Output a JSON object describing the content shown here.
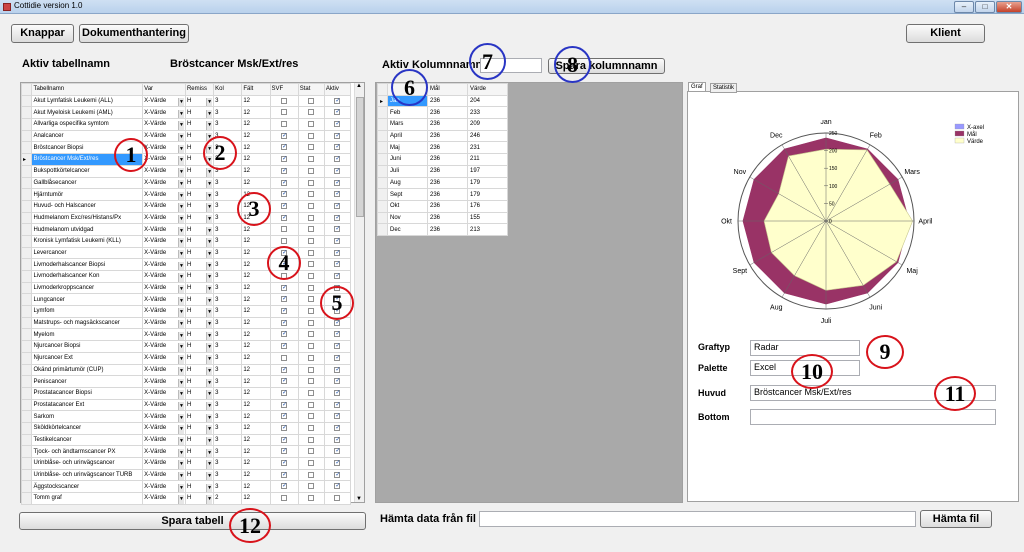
{
  "window": {
    "title": "Cottidie version 1.0"
  },
  "toolbar": {
    "knappar": "Knappar",
    "dokument": "Dokumenthantering",
    "klient": "Klient"
  },
  "left": {
    "header": "Aktiv tabellnamn",
    "active_name": "Bröstcancer Msk/Ext/res",
    "columns": [
      "Tabellnamn",
      "Var",
      "Remiss",
      "Kol",
      "Fält",
      "SVF",
      "Stat",
      "Aktiv"
    ],
    "rows": [
      {
        "name": "Akut Lymfatisk Leukemi (ALL)",
        "var": "X-Värde",
        "rem": "H",
        "kol": "3",
        "falt": "12",
        "svf": false,
        "stat": false,
        "akt": true
      },
      {
        "name": "Akut Myeloisk Leukemi (AML)",
        "var": "X-Värde",
        "rem": "H",
        "kol": "3",
        "falt": "12",
        "svf": false,
        "stat": false,
        "akt": true
      },
      {
        "name": "Allvarliga ospecifika symtom",
        "var": "X-Värde",
        "rem": "H",
        "kol": "3",
        "falt": "12",
        "svf": false,
        "stat": false,
        "akt": true
      },
      {
        "name": "Analcancer",
        "var": "X-Värde",
        "rem": "H",
        "kol": "3",
        "falt": "12",
        "svf": true,
        "stat": false,
        "akt": true
      },
      {
        "name": "Bröstcancer Biopsi",
        "var": "X-Värde",
        "rem": "H",
        "kol": "3",
        "falt": "12",
        "svf": true,
        "stat": false,
        "akt": true
      },
      {
        "name": "Bröstcancer Msk/Ext/res",
        "var": "X-Värde",
        "rem": "H",
        "kol": "3",
        "falt": "12",
        "svf": true,
        "stat": false,
        "akt": true,
        "selected": true
      },
      {
        "name": "Bukspottkörtelcancer",
        "var": "X-Värde",
        "rem": "H",
        "kol": "3",
        "falt": "12",
        "svf": true,
        "stat": false,
        "akt": true
      },
      {
        "name": "Gallblåsecancer",
        "var": "X-Värde",
        "rem": "H",
        "kol": "3",
        "falt": "12",
        "svf": true,
        "stat": false,
        "akt": true
      },
      {
        "name": "Hjärntumör",
        "var": "X-Värde",
        "rem": "H",
        "kol": "3",
        "falt": "12",
        "svf": true,
        "stat": false,
        "akt": true
      },
      {
        "name": "Huvud- och Halscancer",
        "var": "X-Värde",
        "rem": "H",
        "kol": "3",
        "falt": "12",
        "svf": true,
        "stat": false,
        "akt": true
      },
      {
        "name": "Hudmelanom Exc/res/Histans/Px",
        "var": "X-Värde",
        "rem": "H",
        "kol": "3",
        "falt": "12",
        "svf": true,
        "stat": false,
        "akt": true
      },
      {
        "name": "Hudmelanom utvidgad",
        "var": "X-Värde",
        "rem": "H",
        "kol": "3",
        "falt": "12",
        "svf": false,
        "stat": false,
        "akt": true
      },
      {
        "name": "Kronisk Lymfatisk Leukemi (KLL)",
        "var": "X-Värde",
        "rem": "H",
        "kol": "3",
        "falt": "12",
        "svf": false,
        "stat": false,
        "akt": true
      },
      {
        "name": "Levercancer",
        "var": "X-Värde",
        "rem": "H",
        "kol": "3",
        "falt": "12",
        "svf": true,
        "stat": false,
        "akt": true
      },
      {
        "name": "Livmoderhalscancer Biopsi",
        "var": "X-Värde",
        "rem": "H",
        "kol": "3",
        "falt": "12",
        "svf": true,
        "stat": false,
        "akt": true
      },
      {
        "name": "Livmoderhalscancer Kon",
        "var": "X-Värde",
        "rem": "H",
        "kol": "3",
        "falt": "12",
        "svf": false,
        "stat": false,
        "akt": true
      },
      {
        "name": "Livmoderkroppscancer",
        "var": "X-Värde",
        "rem": "H",
        "kol": "3",
        "falt": "12",
        "svf": true,
        "stat": false,
        "akt": true
      },
      {
        "name": "Lungcancer",
        "var": "X-Värde",
        "rem": "H",
        "kol": "3",
        "falt": "12",
        "svf": true,
        "stat": false,
        "akt": true
      },
      {
        "name": "Lymfom",
        "var": "X-Värde",
        "rem": "H",
        "kol": "3",
        "falt": "12",
        "svf": true,
        "stat": false,
        "akt": true
      },
      {
        "name": "Matstrups- och magsäckscancer",
        "var": "X-Värde",
        "rem": "H",
        "kol": "3",
        "falt": "12",
        "svf": true,
        "stat": false,
        "akt": true
      },
      {
        "name": "Myelom",
        "var": "X-Värde",
        "rem": "H",
        "kol": "3",
        "falt": "12",
        "svf": true,
        "stat": false,
        "akt": true
      },
      {
        "name": "Njurcancer Biopsi",
        "var": "X-Värde",
        "rem": "H",
        "kol": "3",
        "falt": "12",
        "svf": true,
        "stat": false,
        "akt": true
      },
      {
        "name": "Njurcancer Ext",
        "var": "X-Värde",
        "rem": "H",
        "kol": "3",
        "falt": "12",
        "svf": false,
        "stat": false,
        "akt": true
      },
      {
        "name": "Okänd primärtumör (CUP)",
        "var": "X-Värde",
        "rem": "H",
        "kol": "3",
        "falt": "12",
        "svf": true,
        "stat": false,
        "akt": true
      },
      {
        "name": "Peniscancer",
        "var": "X-Värde",
        "rem": "H",
        "kol": "3",
        "falt": "12",
        "svf": true,
        "stat": false,
        "akt": true
      },
      {
        "name": "Prostatacancer Biopsi",
        "var": "X-Värde",
        "rem": "H",
        "kol": "3",
        "falt": "12",
        "svf": true,
        "stat": false,
        "akt": true
      },
      {
        "name": "Prostatacancer Ext",
        "var": "X-Värde",
        "rem": "H",
        "kol": "3",
        "falt": "12",
        "svf": true,
        "stat": false,
        "akt": true
      },
      {
        "name": "Sarkom",
        "var": "X-Värde",
        "rem": "H",
        "kol": "3",
        "falt": "12",
        "svf": true,
        "stat": false,
        "akt": true
      },
      {
        "name": "Sköldkörtelcancer",
        "var": "X-Värde",
        "rem": "H",
        "kol": "3",
        "falt": "12",
        "svf": true,
        "stat": false,
        "akt": true
      },
      {
        "name": "Testikelcancer",
        "var": "X-Värde",
        "rem": "H",
        "kol": "3",
        "falt": "12",
        "svf": true,
        "stat": false,
        "akt": true
      },
      {
        "name": "Tjock- och ändtarmscancer PX",
        "var": "X-Värde",
        "rem": "H",
        "kol": "3",
        "falt": "12",
        "svf": true,
        "stat": false,
        "akt": true
      },
      {
        "name": "Urinblåse- och urinvägscancer",
        "var": "X-Värde",
        "rem": "H",
        "kol": "3",
        "falt": "12",
        "svf": true,
        "stat": false,
        "akt": true
      },
      {
        "name": "Urinblåse- och urinvägscancer TURB",
        "var": "X-Värde",
        "rem": "H",
        "kol": "3",
        "falt": "12",
        "svf": true,
        "stat": false,
        "akt": true
      },
      {
        "name": "Äggstockscancer",
        "var": "X-Värde",
        "rem": "H",
        "kol": "3",
        "falt": "12",
        "svf": true,
        "stat": false,
        "akt": true
      },
      {
        "name": "Tomm graf",
        "var": "X-Värde",
        "rem": "H",
        "kol": "2",
        "falt": "12",
        "svf": false,
        "stat": false,
        "akt": false
      }
    ],
    "save_button": "Spara tabell"
  },
  "middle": {
    "header": "Aktiv Kolumnnamn",
    "save_col_button": "Spara kolumnnamn",
    "columns": [
      "Mål",
      "Värde"
    ],
    "rows": [
      {
        "m": "Jan",
        "mal": "236",
        "varde": "204"
      },
      {
        "m": "Feb",
        "mal": "236",
        "varde": "233"
      },
      {
        "m": "Mars",
        "mal": "236",
        "varde": "209"
      },
      {
        "m": "April",
        "mal": "236",
        "varde": "246"
      },
      {
        "m": "Maj",
        "mal": "236",
        "varde": "231"
      },
      {
        "m": "Juni",
        "mal": "236",
        "varde": "211"
      },
      {
        "m": "Juli",
        "mal": "236",
        "varde": "197"
      },
      {
        "m": "Aug",
        "mal": "236",
        "varde": "179"
      },
      {
        "m": "Sept",
        "mal": "236",
        "varde": "179"
      },
      {
        "m": "Okt",
        "mal": "236",
        "varde": "176"
      },
      {
        "m": "Nov",
        "mal": "236",
        "varde": "155"
      },
      {
        "m": "Dec",
        "mal": "236",
        "varde": "213"
      }
    ],
    "fetch_label": "Hämta data från fil",
    "fetch_button": "Hämta fil"
  },
  "right": {
    "tabs": [
      "Graf",
      "Statistik"
    ],
    "graftyp_label": "Graftyp",
    "graftyp_value": "Radar",
    "palette_label": "Palette",
    "palette_value": "Excel",
    "huvud_label": "Huvud",
    "huvud_value": "Bröstcancer Msk/Ext/res",
    "bottom_label": "Bottom",
    "bottom_value": ""
  },
  "chart_data": {
    "type": "radar",
    "categories": [
      "Jan",
      "Feb",
      "Mars",
      "April",
      "Maj",
      "Juni",
      "Juli",
      "Aug",
      "Sept",
      "Okt",
      "Nov",
      "Dec"
    ],
    "rmax": 250,
    "ticks": [
      "0",
      "50",
      "100",
      "150",
      "200",
      "250"
    ],
    "series": [
      {
        "name": "X-axel",
        "values": [
          0,
          0,
          0,
          0,
          0,
          0,
          0,
          0,
          0,
          0,
          0,
          0
        ],
        "color": "#9999ff"
      },
      {
        "name": "Mål",
        "values": [
          236,
          236,
          236,
          236,
          236,
          236,
          236,
          236,
          236,
          236,
          236,
          236
        ],
        "color": "#993366"
      },
      {
        "name": "Värde",
        "values": [
          204,
          233,
          209,
          246,
          231,
          211,
          197,
          179,
          179,
          176,
          155,
          213
        ],
        "color": "#ffffcc"
      }
    ],
    "legend_position": "top-right"
  },
  "annotations": [
    "1",
    "2",
    "3",
    "4",
    "5",
    "6",
    "7",
    "8",
    "9",
    "10",
    "11",
    "12"
  ]
}
